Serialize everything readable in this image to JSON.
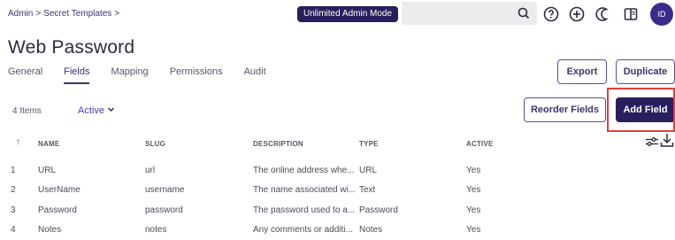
{
  "breadcrumb": {
    "root": "Admin",
    "sep1": ">",
    "section": "Secret Templates",
    "sep2": ">"
  },
  "mode_badge": "Unlimited Admin Mode",
  "avatar_initials": "ID",
  "page_title": "Web Password",
  "tabs": [
    {
      "label": "General",
      "active": false
    },
    {
      "label": "Fields",
      "active": true
    },
    {
      "label": "Mapping",
      "active": false
    },
    {
      "label": "Permissions",
      "active": false
    },
    {
      "label": "Audit",
      "active": false
    }
  ],
  "buttons": {
    "export": "Export",
    "duplicate": "Duplicate",
    "reorder": "Reorder Fields",
    "add_field": "Add Field"
  },
  "items_count": "4 Items",
  "active_filter": "Active",
  "table": {
    "headers": {
      "sort": "↑",
      "name": "NAME",
      "slug": "SLUG",
      "description": "DESCRIPTION",
      "type": "TYPE",
      "active": "ACTIVE"
    },
    "rows": [
      {
        "num": "1",
        "name": "URL",
        "slug": "url",
        "description": "The online address whe...",
        "type": "URL",
        "active": "Yes"
      },
      {
        "num": "2",
        "name": "UserName",
        "slug": "username",
        "description": "The name associated wi...",
        "type": "Text",
        "active": "Yes"
      },
      {
        "num": "3",
        "name": "Password",
        "slug": "password",
        "description": "The password used to a...",
        "type": "Password",
        "active": "Yes"
      },
      {
        "num": "4",
        "name": "Notes",
        "slug": "notes",
        "description": "Any comments or additi...",
        "type": "Notes",
        "active": "Yes"
      }
    ]
  },
  "colors": {
    "brand": "#2a1f5c",
    "accent": "#4b3fb0",
    "highlight": "#e0403a"
  },
  "icons": [
    "search-icon",
    "help-icon",
    "add-circle-icon",
    "dark-mode-icon",
    "panel-icon",
    "filter-settings-icon",
    "download-icon",
    "chevron-down-icon"
  ]
}
